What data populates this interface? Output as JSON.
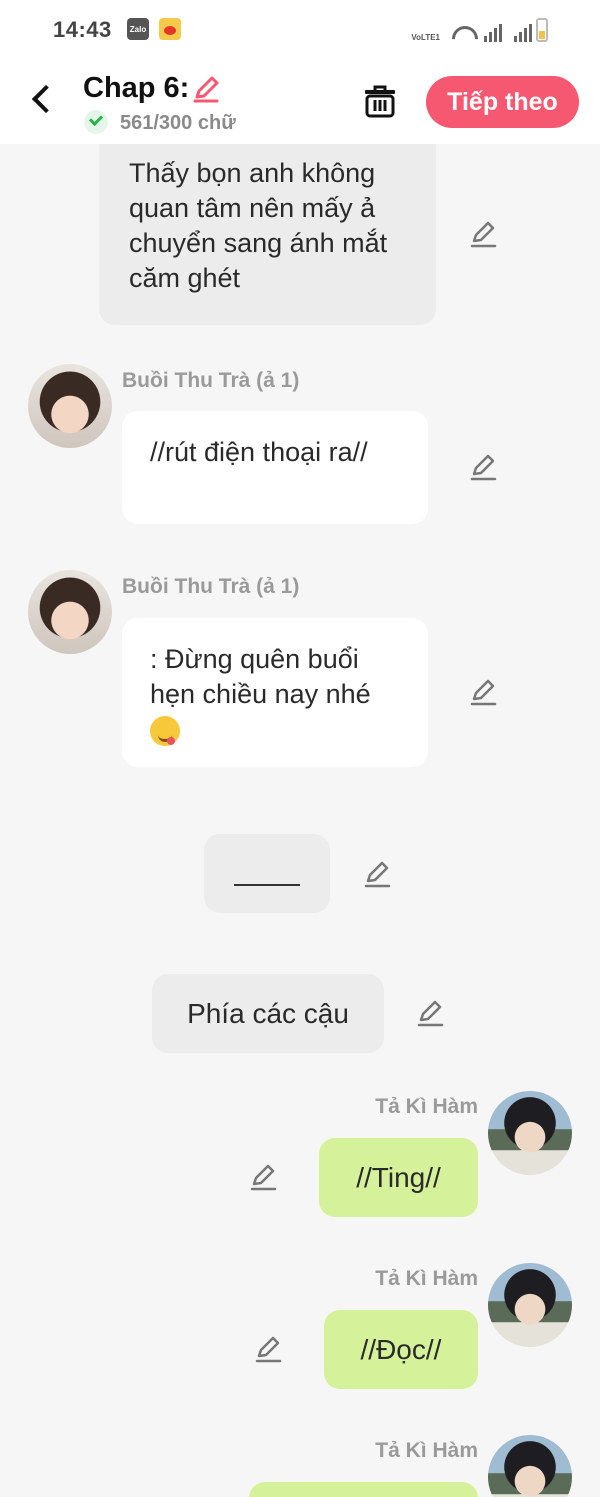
{
  "status_bar": {
    "time": "14:43",
    "apps": [
      "zalo-icon",
      "weibo-icon"
    ],
    "zalo_label": "Zalo",
    "volte": "VoLTE1",
    "icons": [
      "wifi-icon",
      "signal-icon",
      "signal-icon",
      "battery-icon"
    ]
  },
  "header": {
    "back_icon": "chevron-left-icon",
    "title": "Chap 6:",
    "edit_icon": "pencil-icon",
    "word_count": "561/300 chữ",
    "delete_icon": "trash-icon",
    "next_label": "Tiếp theo",
    "accent_color": "#f55870"
  },
  "messages": [
    {
      "type": "narration",
      "text": "Thấy bọn anh không quan tâm nên mấy ả chuyển sang ánh mắt căm ghét"
    },
    {
      "type": "left",
      "sender": "Buồi Thu Trà (ả 1)",
      "text": "//rút điện thoại ra//"
    },
    {
      "type": "left",
      "sender": "Buồi Thu Trà (ả 1)",
      "text": ": Đừng quên buổi hẹn chiều nay nhé",
      "emoji": "yum-face-icon"
    },
    {
      "type": "narration",
      "text": "____"
    },
    {
      "type": "narration",
      "text": "Phía các cậu"
    },
    {
      "type": "right",
      "sender": "Tả Kì Hàm",
      "text": "//Ting//"
    },
    {
      "type": "right",
      "sender": "Tả Kì Hàm",
      "text": "//Đọc//"
    },
    {
      "type": "right",
      "sender": "Tả Kì Hàm",
      "text": ""
    }
  ]
}
